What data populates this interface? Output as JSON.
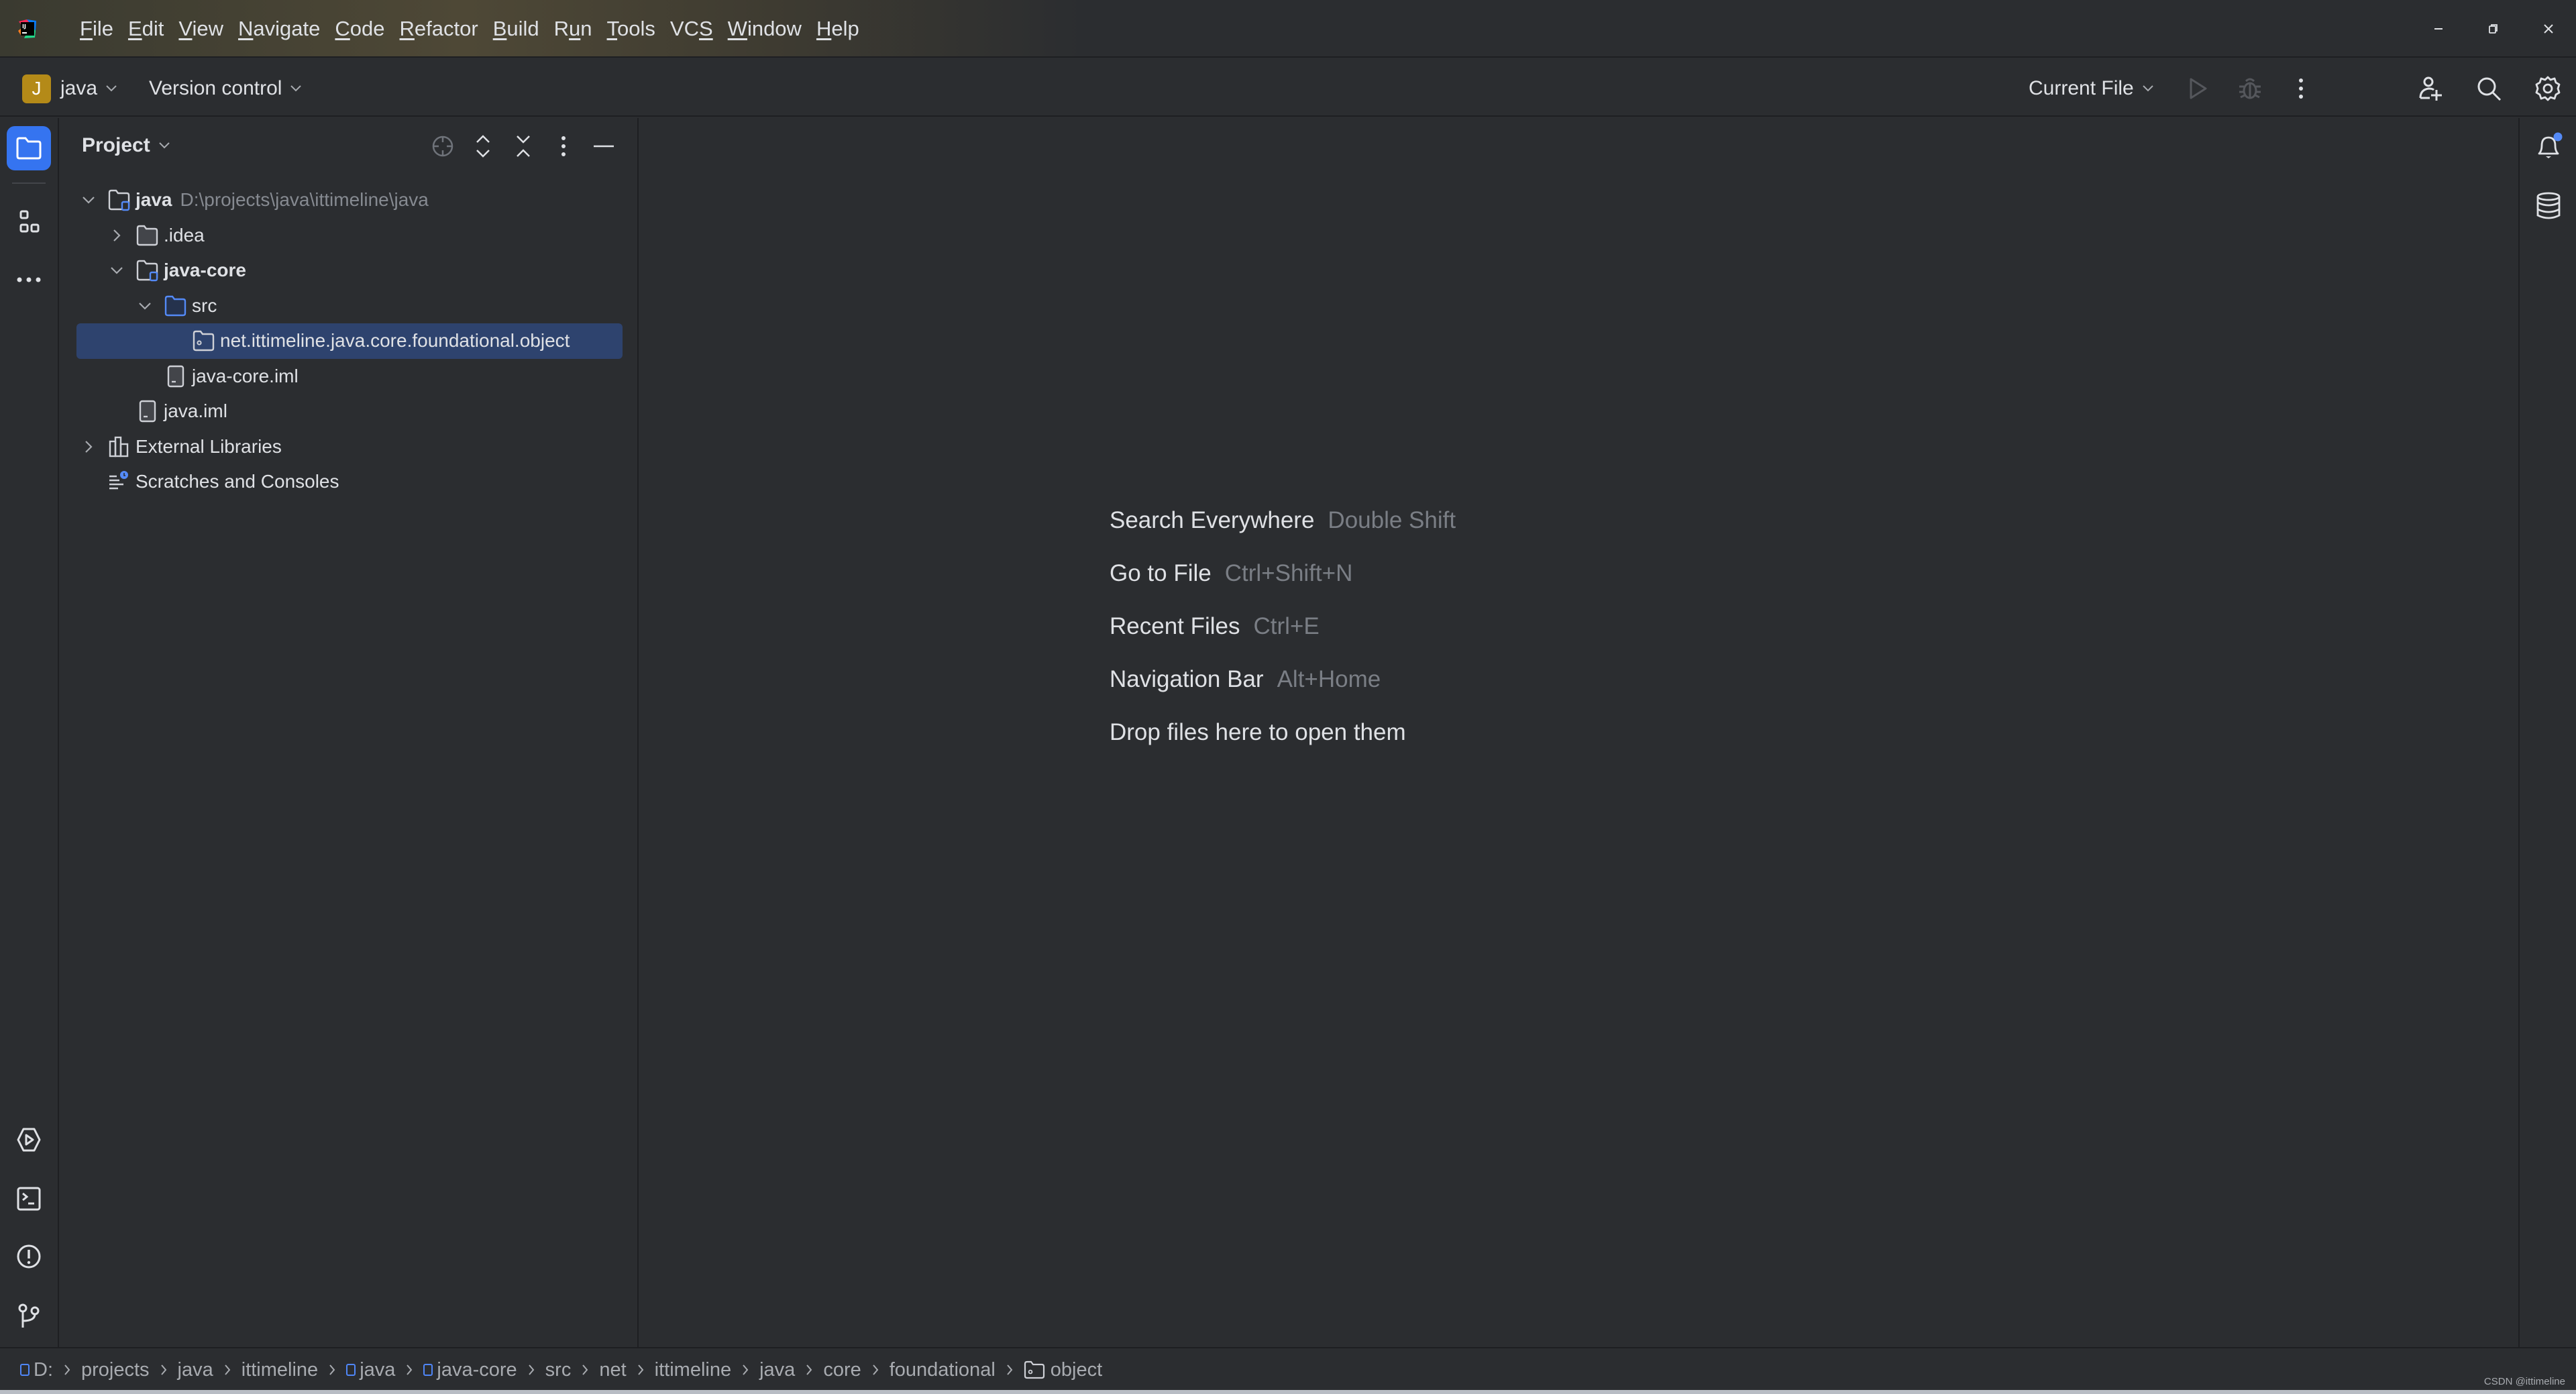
{
  "app": {
    "logo_icon": "intellij-idea-logo",
    "menu": [
      {
        "label": "File",
        "mnemonic": "F"
      },
      {
        "label": "Edit",
        "mnemonic": "E"
      },
      {
        "label": "View",
        "mnemonic": "V"
      },
      {
        "label": "Navigate",
        "mnemonic": "N"
      },
      {
        "label": "Code",
        "mnemonic": "C"
      },
      {
        "label": "Refactor",
        "mnemonic": "R"
      },
      {
        "label": "Build",
        "mnemonic": "B"
      },
      {
        "label": "Run",
        "mnemonic": "u"
      },
      {
        "label": "Tools",
        "mnemonic": "T"
      },
      {
        "label": "VCS",
        "mnemonic": "S"
      },
      {
        "label": "Window",
        "mnemonic": "W"
      },
      {
        "label": "Help",
        "mnemonic": "H"
      }
    ],
    "window_controls": [
      "minimize",
      "restore",
      "close"
    ]
  },
  "toolbar": {
    "project_badge": "J",
    "project_name": "java",
    "vcs_label": "Version control",
    "run_config": "Current File",
    "icons": [
      "run-icon",
      "debug-icon",
      "more-actions-icon",
      "code-with-me-icon",
      "search-icon",
      "settings-icon"
    ]
  },
  "left_strip": {
    "top": [
      "project-icon",
      "structure-icon",
      "more-tools-icon"
    ],
    "bottom": [
      "services-icon",
      "terminal-icon",
      "problems-icon",
      "git-icon"
    ]
  },
  "project_panel": {
    "title": "Project",
    "actions": [
      "locate-icon",
      "expand-all-icon",
      "collapse-all-icon",
      "options-icon",
      "hide-icon"
    ],
    "tree": [
      {
        "label": "java",
        "path": "D:\\projects\\java\\ittimeline\\java",
        "depth": 0,
        "expanded": true,
        "type": "module",
        "bold": true
      },
      {
        "label": ".idea",
        "depth": 1,
        "expanded": false,
        "type": "folder"
      },
      {
        "label": "java-core",
        "depth": 1,
        "expanded": true,
        "type": "module",
        "bold": true
      },
      {
        "label": "src",
        "depth": 2,
        "expanded": true,
        "type": "source-folder"
      },
      {
        "label": "net.ittimeline.java.core.foundational.object",
        "depth": 3,
        "type": "package",
        "selected": true
      },
      {
        "label": "java-core.iml",
        "depth": 2,
        "type": "file"
      },
      {
        "label": "java.iml",
        "depth": 1,
        "type": "file"
      },
      {
        "label": "External Libraries",
        "depth": 0,
        "expanded": false,
        "type": "libraries"
      },
      {
        "label": "Scratches and Consoles",
        "depth": 0,
        "type": "scratches"
      }
    ]
  },
  "editor": {
    "hints": [
      {
        "action": "Search Everywhere",
        "shortcut": "Double Shift"
      },
      {
        "action": "Go to File",
        "shortcut": "Ctrl+Shift+N"
      },
      {
        "action": "Recent Files",
        "shortcut": "Ctrl+E"
      },
      {
        "action": "Navigation Bar",
        "shortcut": "Alt+Home"
      },
      {
        "action": "Drop files here to open them",
        "shortcut": ""
      }
    ]
  },
  "right_strip": {
    "icons": [
      "notifications-icon",
      "database-icon"
    ],
    "notification_badge": true
  },
  "statusbar": {
    "breadcrumbs": [
      {
        "label": "D:",
        "icon": "module"
      },
      {
        "label": "projects"
      },
      {
        "label": "java"
      },
      {
        "label": "ittimeline"
      },
      {
        "label": "java",
        "icon": "module"
      },
      {
        "label": "java-core",
        "icon": "module"
      },
      {
        "label": "src"
      },
      {
        "label": "net"
      },
      {
        "label": "ittimeline"
      },
      {
        "label": "java"
      },
      {
        "label": "core"
      },
      {
        "label": "foundational"
      },
      {
        "label": "object",
        "icon": "package"
      }
    ],
    "watermark": "CSDN @ittimeline"
  },
  "colors": {
    "accent": "#3574f0",
    "selection": "#2e436e",
    "background": "#2b2d30",
    "project_badge": "#b48a18",
    "notification_dot": "#548af7"
  }
}
